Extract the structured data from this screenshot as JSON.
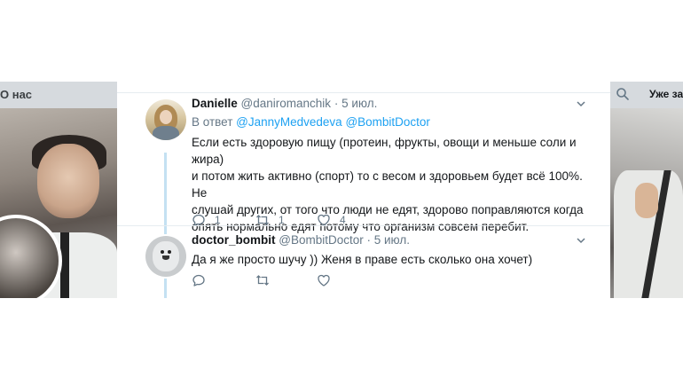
{
  "left_panel": {
    "nav_label": "О нас"
  },
  "right_panel": {
    "header_text": "Уже зар"
  },
  "tweets": [
    {
      "display_name": "Danielle",
      "handle": "@daniromanchik",
      "separator": " · ",
      "time": "5 июл.",
      "reply_prefix": "В ответ ",
      "reply_mentions": "@JannyMedvedeva @BombitDoctor",
      "text": "Если есть здоровую пищу (протеин, фрукты, овощи и меньше соли и жира)\nи потом жить активно (спорт) то с весом и здоровьем будет всё 100%. Не\nслушай других, от того что люди не едят, здорово поправляются когда\nопять нормально едят потому что организм совсем перебит.",
      "replies": "1",
      "retweets": "1",
      "likes": "4"
    },
    {
      "display_name": "doctor_bombit",
      "handle": "@BombitDoctor",
      "separator": " · ",
      "time": "5 июл.",
      "text": "Да я же просто шучу )) Женя в праве есть сколько она хочет)",
      "replies": "",
      "retweets": "",
      "likes": ""
    }
  ],
  "colors": {
    "accent": "#1da1f2",
    "secondary_text": "#657786",
    "thread_line": "#c4e1f2"
  }
}
